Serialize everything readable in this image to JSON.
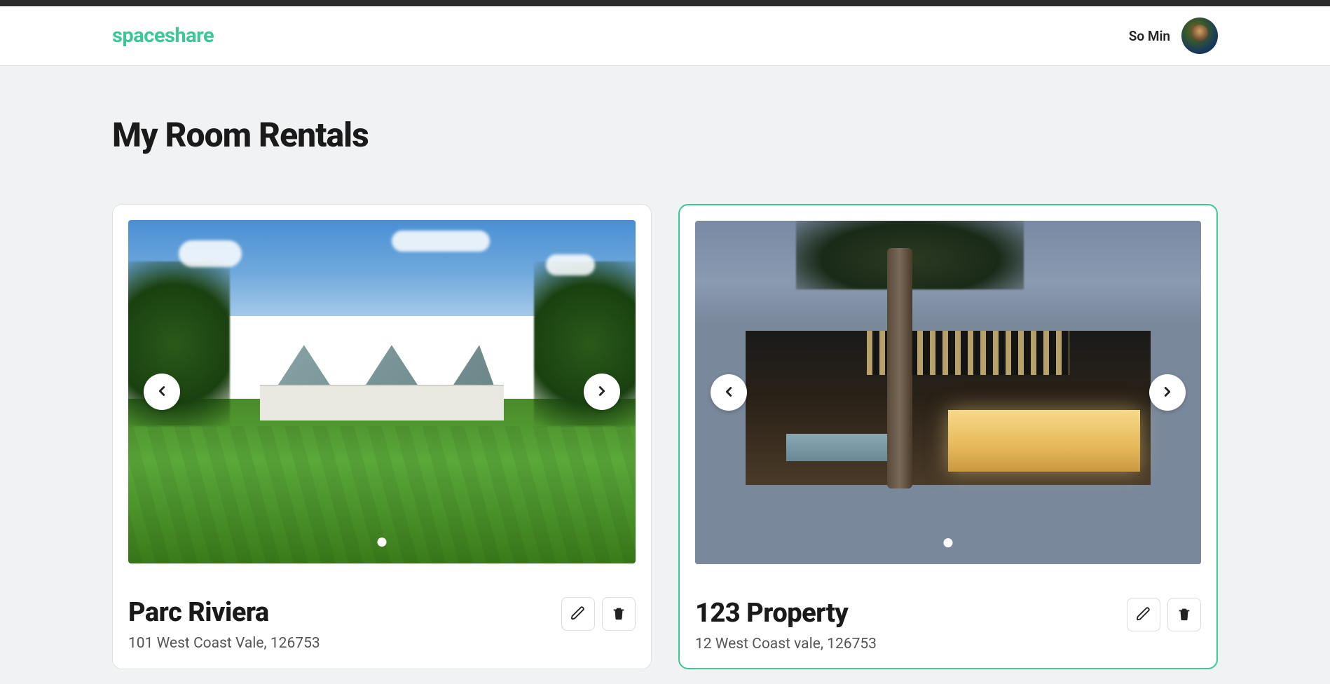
{
  "brand": {
    "name": "spaceshare"
  },
  "user": {
    "display_name": "So Min"
  },
  "page": {
    "title": "My Room Rentals"
  },
  "listings": [
    {
      "title": "Parc Riviera",
      "address": "101 West Coast Vale, 126753",
      "highlighted": false
    },
    {
      "title": "123 Property",
      "address": "12 West Coast vale, 126753",
      "highlighted": true
    }
  ]
}
